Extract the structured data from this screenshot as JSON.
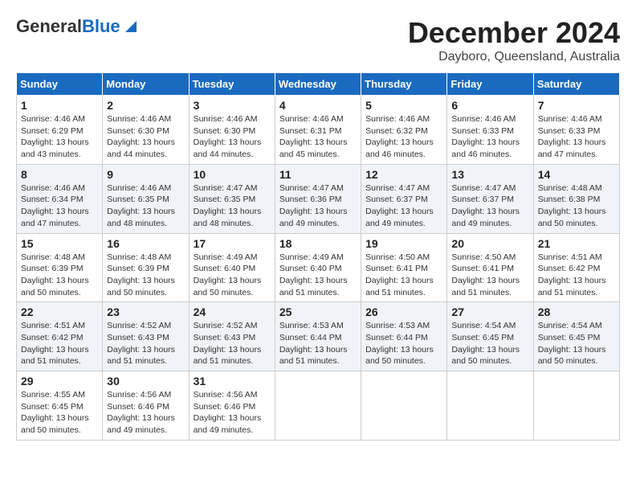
{
  "logo": {
    "general": "General",
    "blue": "Blue"
  },
  "title": {
    "month": "December 2024",
    "location": "Dayboro, Queensland, Australia"
  },
  "calendar": {
    "headers": [
      "Sunday",
      "Monday",
      "Tuesday",
      "Wednesday",
      "Thursday",
      "Friday",
      "Saturday"
    ],
    "weeks": [
      [
        null,
        {
          "day": "2",
          "sunrise": "Sunrise: 4:46 AM",
          "sunset": "Sunset: 6:30 PM",
          "daylight": "Daylight: 13 hours and 44 minutes."
        },
        {
          "day": "3",
          "sunrise": "Sunrise: 4:46 AM",
          "sunset": "Sunset: 6:30 PM",
          "daylight": "Daylight: 13 hours and 44 minutes."
        },
        {
          "day": "4",
          "sunrise": "Sunrise: 4:46 AM",
          "sunset": "Sunset: 6:31 PM",
          "daylight": "Daylight: 13 hours and 45 minutes."
        },
        {
          "day": "5",
          "sunrise": "Sunrise: 4:46 AM",
          "sunset": "Sunset: 6:32 PM",
          "daylight": "Daylight: 13 hours and 46 minutes."
        },
        {
          "day": "6",
          "sunrise": "Sunrise: 4:46 AM",
          "sunset": "Sunset: 6:33 PM",
          "daylight": "Daylight: 13 hours and 46 minutes."
        },
        {
          "day": "7",
          "sunrise": "Sunrise: 4:46 AM",
          "sunset": "Sunset: 6:33 PM",
          "daylight": "Daylight: 13 hours and 47 minutes."
        }
      ],
      [
        {
          "day": "1",
          "sunrise": "Sunrise: 4:46 AM",
          "sunset": "Sunset: 6:29 PM",
          "daylight": "Daylight: 13 hours and 43 minutes."
        },
        null,
        null,
        null,
        null,
        null,
        null
      ],
      [
        {
          "day": "8",
          "sunrise": "Sunrise: 4:46 AM",
          "sunset": "Sunset: 6:34 PM",
          "daylight": "Daylight: 13 hours and 47 minutes."
        },
        {
          "day": "9",
          "sunrise": "Sunrise: 4:46 AM",
          "sunset": "Sunset: 6:35 PM",
          "daylight": "Daylight: 13 hours and 48 minutes."
        },
        {
          "day": "10",
          "sunrise": "Sunrise: 4:47 AM",
          "sunset": "Sunset: 6:35 PM",
          "daylight": "Daylight: 13 hours and 48 minutes."
        },
        {
          "day": "11",
          "sunrise": "Sunrise: 4:47 AM",
          "sunset": "Sunset: 6:36 PM",
          "daylight": "Daylight: 13 hours and 49 minutes."
        },
        {
          "day": "12",
          "sunrise": "Sunrise: 4:47 AM",
          "sunset": "Sunset: 6:37 PM",
          "daylight": "Daylight: 13 hours and 49 minutes."
        },
        {
          "day": "13",
          "sunrise": "Sunrise: 4:47 AM",
          "sunset": "Sunset: 6:37 PM",
          "daylight": "Daylight: 13 hours and 49 minutes."
        },
        {
          "day": "14",
          "sunrise": "Sunrise: 4:48 AM",
          "sunset": "Sunset: 6:38 PM",
          "daylight": "Daylight: 13 hours and 50 minutes."
        }
      ],
      [
        {
          "day": "15",
          "sunrise": "Sunrise: 4:48 AM",
          "sunset": "Sunset: 6:39 PM",
          "daylight": "Daylight: 13 hours and 50 minutes."
        },
        {
          "day": "16",
          "sunrise": "Sunrise: 4:48 AM",
          "sunset": "Sunset: 6:39 PM",
          "daylight": "Daylight: 13 hours and 50 minutes."
        },
        {
          "day": "17",
          "sunrise": "Sunrise: 4:49 AM",
          "sunset": "Sunset: 6:40 PM",
          "daylight": "Daylight: 13 hours and 50 minutes."
        },
        {
          "day": "18",
          "sunrise": "Sunrise: 4:49 AM",
          "sunset": "Sunset: 6:40 PM",
          "daylight": "Daylight: 13 hours and 51 minutes."
        },
        {
          "day": "19",
          "sunrise": "Sunrise: 4:50 AM",
          "sunset": "Sunset: 6:41 PM",
          "daylight": "Daylight: 13 hours and 51 minutes."
        },
        {
          "day": "20",
          "sunrise": "Sunrise: 4:50 AM",
          "sunset": "Sunset: 6:41 PM",
          "daylight": "Daylight: 13 hours and 51 minutes."
        },
        {
          "day": "21",
          "sunrise": "Sunrise: 4:51 AM",
          "sunset": "Sunset: 6:42 PM",
          "daylight": "Daylight: 13 hours and 51 minutes."
        }
      ],
      [
        {
          "day": "22",
          "sunrise": "Sunrise: 4:51 AM",
          "sunset": "Sunset: 6:42 PM",
          "daylight": "Daylight: 13 hours and 51 minutes."
        },
        {
          "day": "23",
          "sunrise": "Sunrise: 4:52 AM",
          "sunset": "Sunset: 6:43 PM",
          "daylight": "Daylight: 13 hours and 51 minutes."
        },
        {
          "day": "24",
          "sunrise": "Sunrise: 4:52 AM",
          "sunset": "Sunset: 6:43 PM",
          "daylight": "Daylight: 13 hours and 51 minutes."
        },
        {
          "day": "25",
          "sunrise": "Sunrise: 4:53 AM",
          "sunset": "Sunset: 6:44 PM",
          "daylight": "Daylight: 13 hours and 51 minutes."
        },
        {
          "day": "26",
          "sunrise": "Sunrise: 4:53 AM",
          "sunset": "Sunset: 6:44 PM",
          "daylight": "Daylight: 13 hours and 50 minutes."
        },
        {
          "day": "27",
          "sunrise": "Sunrise: 4:54 AM",
          "sunset": "Sunset: 6:45 PM",
          "daylight": "Daylight: 13 hours and 50 minutes."
        },
        {
          "day": "28",
          "sunrise": "Sunrise: 4:54 AM",
          "sunset": "Sunset: 6:45 PM",
          "daylight": "Daylight: 13 hours and 50 minutes."
        }
      ],
      [
        {
          "day": "29",
          "sunrise": "Sunrise: 4:55 AM",
          "sunset": "Sunset: 6:45 PM",
          "daylight": "Daylight: 13 hours and 50 minutes."
        },
        {
          "day": "30",
          "sunrise": "Sunrise: 4:56 AM",
          "sunset": "Sunset: 6:46 PM",
          "daylight": "Daylight: 13 hours and 49 minutes."
        },
        {
          "day": "31",
          "sunrise": "Sunrise: 4:56 AM",
          "sunset": "Sunset: 6:46 PM",
          "daylight": "Daylight: 13 hours and 49 minutes."
        },
        null,
        null,
        null,
        null
      ]
    ]
  }
}
